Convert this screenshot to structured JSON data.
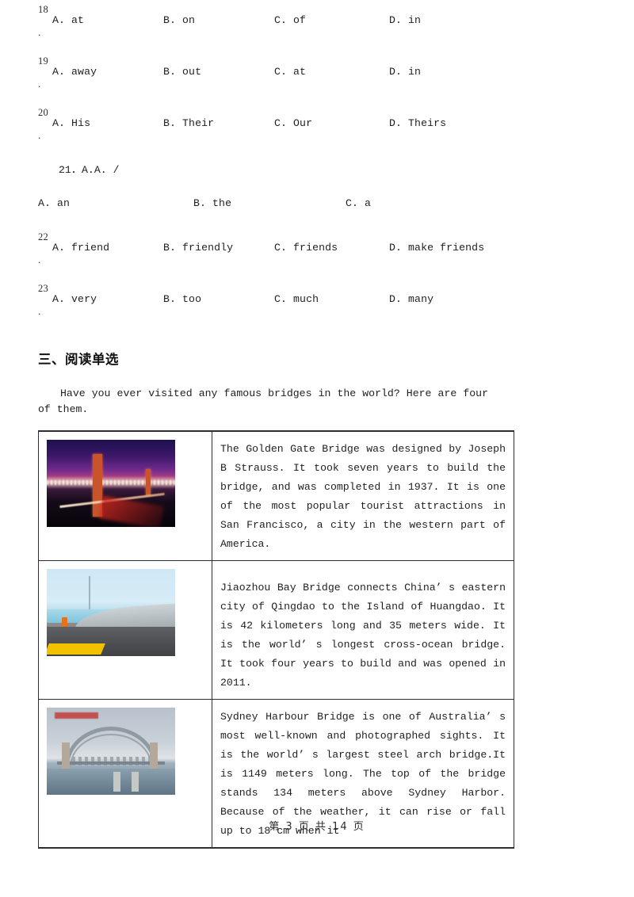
{
  "document": {
    "footer": "第 3 页 共 14 页"
  },
  "cloze_questions": [
    {
      "number": "18",
      "dot": ".",
      "options": [
        "A. at",
        "B. on",
        "C. of",
        "D. in"
      ]
    },
    {
      "number": "19",
      "dot": ".",
      "options": [
        "A. away",
        "B. out",
        "C. at",
        "D. in"
      ]
    },
    {
      "number": "20",
      "dot": ".",
      "options": [
        "A. His",
        "B. Their",
        "C. Our",
        "D. Theirs"
      ]
    }
  ],
  "question_21": {
    "stem": "21．A.A. /",
    "options": [
      "A. an",
      "B. the",
      "C. a"
    ]
  },
  "cloze_questions_2": [
    {
      "number": "22",
      "dot": ".",
      "options": [
        "A. friend",
        "B. friendly",
        "C. friends",
        "D. make friends"
      ]
    },
    {
      "number": "23",
      "dot": ".",
      "options": [
        "A. very",
        "B. too",
        "C. much",
        "D. many"
      ]
    }
  ],
  "reading_section": {
    "heading": "三、阅读单选",
    "intro": "Have you ever visited any famous bridges in the world? Here are four of them.",
    "rows": [
      {
        "image_name": "golden-gate-bridge-photo",
        "text": "The Golden Gate Bridge was designed by Joseph B Strauss. It took seven years to build the bridge, and was completed in 1937. It is one of the most popular tourist attractions in San Francisco, a city in the western part of America."
      },
      {
        "image_name": "jiaozhou-bay-bridge-photo",
        "text": "Jiaozhou Bay Bridge connects China’ s eastern city of Qingdao to the Island of Huangdao. It is 42 kilometers long and 35 meters wide. It is the world’ s longest cross-ocean bridge. It took four years to build and was opened in 2011."
      },
      {
        "image_name": "sydney-harbour-bridge-photo",
        "text": "Sydney Harbour Bridge is one of Australia’ s most well-known and photographed sights. It is the world’ s largest steel arch bridge.It is 1149 meters long. The top of the bridge stands 134 meters above Sydney Harbor. Because of the weather, it can rise or fall up to 18 cm when it"
      }
    ]
  },
  "colors": {
    "text": "#1f1f1f",
    "border": "#2e2e2e",
    "page_background": "#ffffff"
  }
}
